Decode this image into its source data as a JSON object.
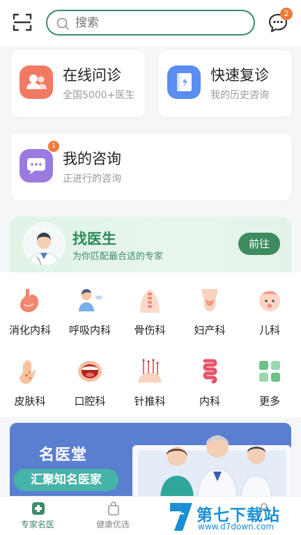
{
  "search": {
    "placeholder": "搜索"
  },
  "header": {
    "message_badge": "2"
  },
  "quick": [
    {
      "title": "在线问诊",
      "sub": "全国5000+医生"
    },
    {
      "title": "快速复诊",
      "sub": "我的历史咨询"
    }
  ],
  "consult": {
    "title": "我的咨询",
    "sub": "正进行的咨询",
    "badge": "1"
  },
  "find_doctor": {
    "title": "找医生",
    "sub": "为你匹配最合适的专家",
    "button": "前往"
  },
  "departments": [
    {
      "label": "消化内科",
      "icon": "stomach-icon"
    },
    {
      "label": "呼吸内科",
      "icon": "respiratory-icon"
    },
    {
      "label": "骨伤科",
      "icon": "spine-icon"
    },
    {
      "label": "妇产科",
      "icon": "uterus-icon"
    },
    {
      "label": "儿科",
      "icon": "baby-icon"
    },
    {
      "label": "皮肤科",
      "icon": "hand-skin-icon"
    },
    {
      "label": "口腔科",
      "icon": "mouth-icon"
    },
    {
      "label": "针推科",
      "icon": "acupuncture-icon"
    },
    {
      "label": "内科",
      "icon": "intestine-icon"
    },
    {
      "label": "更多",
      "icon": "grid-more-icon"
    }
  ],
  "banner": {
    "title": "名医堂",
    "pill": "汇聚知名医家"
  },
  "tabs": [
    {
      "label": "专家名医",
      "active": true
    },
    {
      "label": "健康优选",
      "active": false
    },
    {
      "label": "",
      "active": false
    },
    {
      "label": "",
      "active": false
    }
  ],
  "watermark": {
    "brand": "第七下载站",
    "url": "www.d7down.com"
  },
  "colors": {
    "primary": "#3d8b6a",
    "badge": "#f07a3a",
    "banner": "#5b7fd0"
  }
}
